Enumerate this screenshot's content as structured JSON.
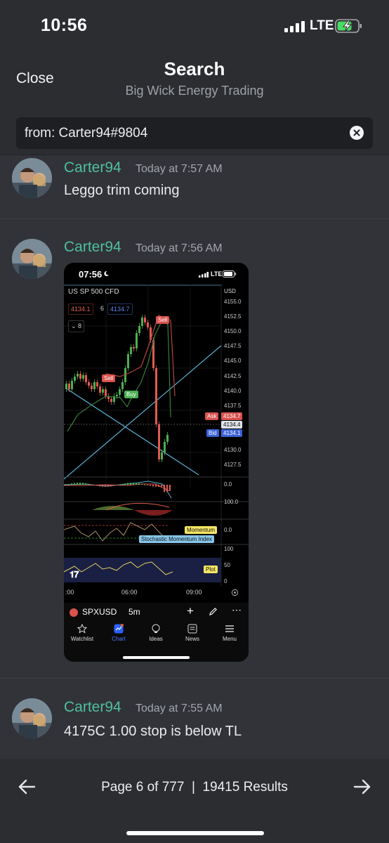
{
  "status": {
    "time": "10:56",
    "network": "LTE"
  },
  "header": {
    "close_label": "Close",
    "title": "Search",
    "subtitle": "Big Wick Energy Trading"
  },
  "search": {
    "value": "from: Carter94#9804"
  },
  "messages": [
    {
      "author": "Carter94",
      "timestamp": "Today at 7:57 AM",
      "text": "Leggo trim coming"
    },
    {
      "author": "Carter94",
      "timestamp": "Today at 7:56 AM",
      "text": ""
    },
    {
      "author": "Carter94",
      "timestamp": "Today at 7:55 AM",
      "text": "4175C 1.00 stop is below TL"
    }
  ],
  "attachment": {
    "time": "07:56",
    "network": "LTE",
    "symbol_title": "US SP 500 CFD",
    "currency": "USD",
    "bid_chip": "4134.1",
    "spread": "6",
    "ask_chip": "4134.7",
    "interval_chip": "8",
    "price_labels": [
      "4155.0",
      "4152.5",
      "4150.0",
      "4147.5",
      "4145.0",
      "4142.5",
      "4140.0",
      "4137.5",
      "4132.5",
      "4130.0",
      "4127.5"
    ],
    "ask_label": "Ask",
    "ask_price": "4134.7",
    "last_price": "4134.4",
    "bid_label": "Bid",
    "bid_price": "4134.1",
    "sell_tag_1": "Sell",
    "sell_tag_2": "Sell",
    "buy_tag": "Buy",
    "macd_zero": "0.0",
    "macd_hundred": "100.0",
    "momentum_label": "Momentum",
    "momentum_zero": "0.0",
    "smi_label": "Stochastic Momentum Index",
    "plot_label": "Plot",
    "rsi_levels": [
      "100",
      "50",
      "0"
    ],
    "time_labels": [
      ":00",
      "06:00",
      "09:00"
    ],
    "toolbar_symbol": "SPXUSD",
    "toolbar_interval": "5m",
    "nav": [
      "Watchlist",
      "Chart",
      "Ideas",
      "News",
      "Menu"
    ]
  },
  "footer": {
    "pager": "Page 6 of 777  |  19415 Results"
  },
  "colors": {
    "author": "#4fbf9f",
    "background": "#313338",
    "header": "#2b2d31"
  }
}
